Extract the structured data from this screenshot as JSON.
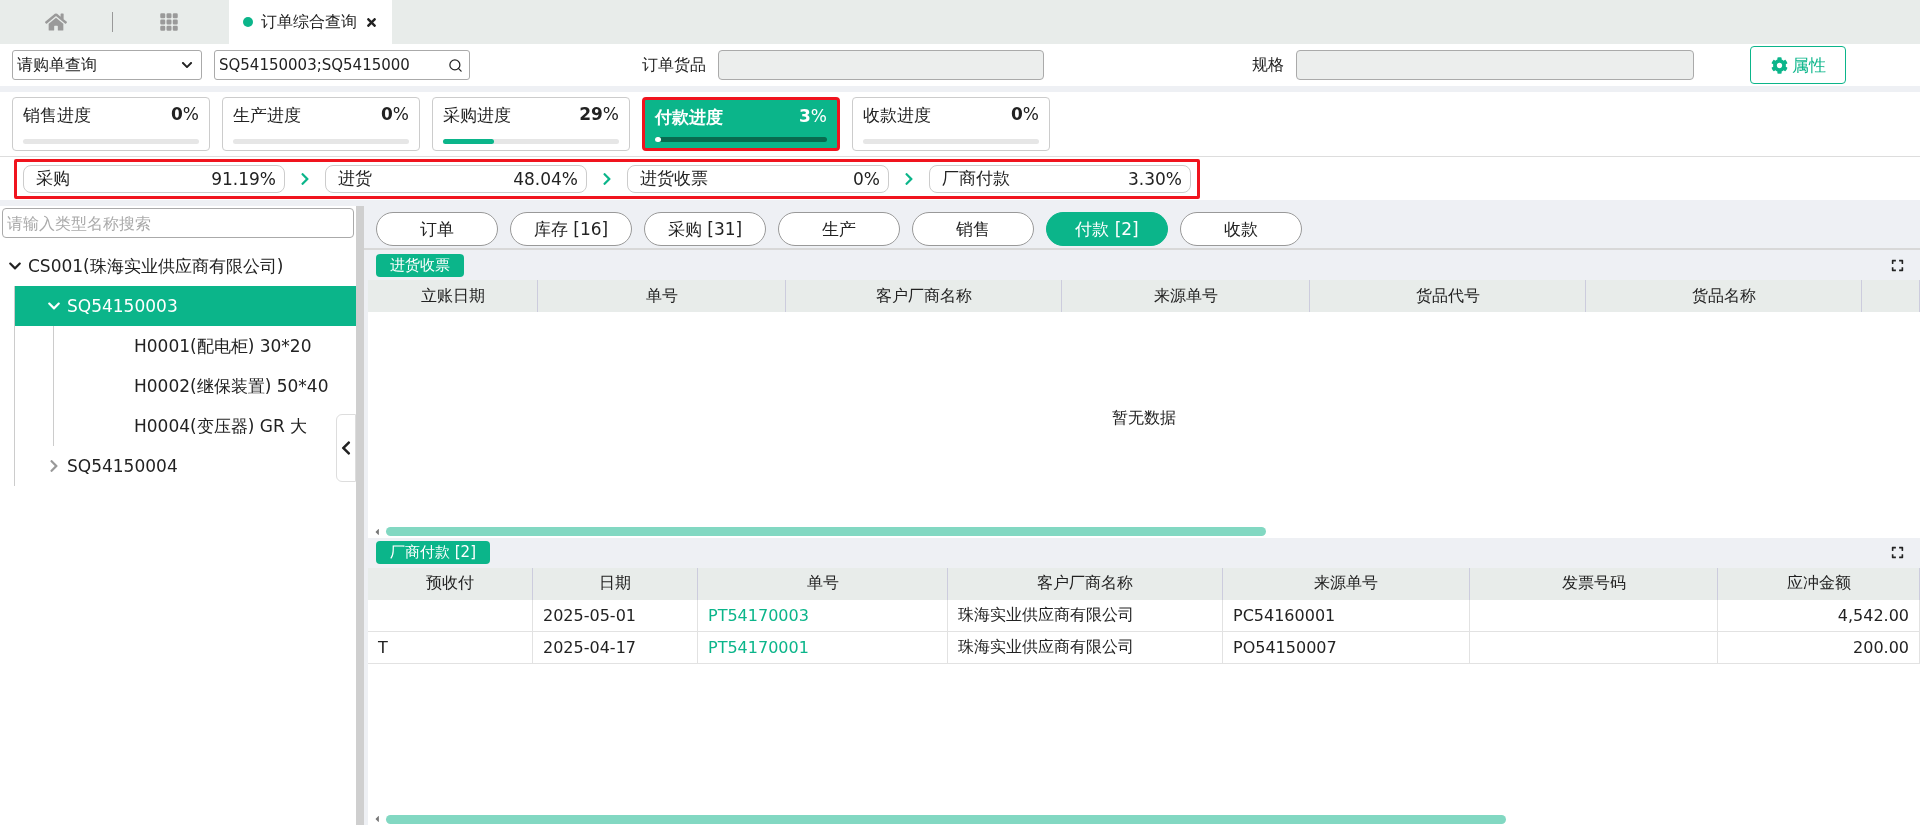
{
  "tabs": [
    {
      "label": "订单综合查询",
      "selected": true
    }
  ],
  "query": {
    "mode": "请购单查询",
    "search_value": "SQ54150003;SQ5415000",
    "goods_label": "订单货品",
    "spec_label": "规格",
    "attributes_button": "属性"
  },
  "progress": [
    {
      "label": "销售进度",
      "value": "**0**%",
      "level": 0,
      "selected": false,
      "highlighted": false
    },
    {
      "label": "生产进度",
      "value": "**0**%",
      "level": 0,
      "selected": false,
      "highlighted": false
    },
    {
      "label": "采购进度",
      "value": "**29**%",
      "level": 0.29,
      "selected": false,
      "highlighted": false
    },
    {
      "label": "付款进度",
      "value": "**3**%",
      "level": 0.03,
      "selected": true,
      "highlighted": true
    },
    {
      "label": "收款进度",
      "value": "**0**%",
      "level": 0,
      "selected": false,
      "highlighted": false
    }
  ],
  "flow": {
    "highlighted": true,
    "steps": [
      {
        "label": "采购",
        "value": "91.19%"
      },
      {
        "label": "进货",
        "value": "48.04%"
      },
      {
        "label": "进货收票",
        "value": "0%"
      },
      {
        "label": "厂商付款",
        "value": "3.30%"
      }
    ]
  },
  "sidebar": {
    "search_placeholder": "请输入类型名称搜索",
    "tree": [
      {
        "label": "CS001(珠海实业供应商有限公司)",
        "expanded": true,
        "selected": false,
        "children": [
          {
            "label": "SQ54150003",
            "expanded": true,
            "selected": true,
            "children": [
              {
                "label": "H0001(配电柜) 30*20",
                "selected": false
              },
              {
                "label": "H0002(继保装置) 50*40",
                "selected": false
              },
              {
                "label": "H0004(变压器) GR 大",
                "selected": false
              }
            ]
          },
          {
            "label": "SQ54150004",
            "expanded": false,
            "selected": false
          }
        ]
      }
    ]
  },
  "view_tabs": [
    {
      "label": "订单",
      "selected": false
    },
    {
      "label": "库存 [16]",
      "selected": false
    },
    {
      "label": "采购 [31]",
      "selected": false
    },
    {
      "label": "生产",
      "selected": false
    },
    {
      "label": "销售",
      "selected": false
    },
    {
      "label": "付款 [2]",
      "selected": true
    },
    {
      "label": "收款",
      "selected": false
    }
  ],
  "sections": [
    {
      "title": "进货收票",
      "columns": [
        "立账日期",
        "单号",
        "客户厂商名称",
        "来源单号",
        "货品代号",
        "货品名称"
      ],
      "empty_text": "暂无数据"
    },
    {
      "title": "厂商付款 [2]",
      "columns": [
        "预收付",
        "日期",
        "单号",
        "客户厂商名称",
        "来源单号",
        "发票号码",
        "应冲金额"
      ],
      "rows": [
        [
          "",
          "2025-05-01",
          "PT54170003",
          "珠海实业供应商有限公司",
          "PC54160001",
          "",
          "4,542.00"
        ],
        [
          "T",
          "2025-04-17",
          "PT54170001",
          "珠海实业供应商有限公司",
          "PO54150007",
          "",
          "200.00"
        ]
      ]
    }
  ]
}
